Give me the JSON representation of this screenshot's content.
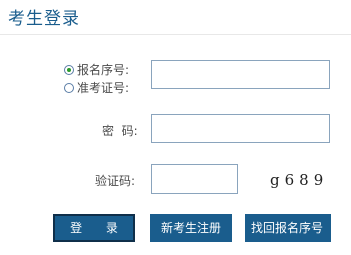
{
  "page": {
    "title": "考生登录"
  },
  "form": {
    "id_options": [
      {
        "label": "报名序号:",
        "checked": true
      },
      {
        "label": "准考证号:",
        "checked": false
      }
    ],
    "id_value": "",
    "password_label": "密  码:",
    "password_value": "",
    "captcha_label": "验证码:",
    "captcha_value": "",
    "captcha_text": "g689"
  },
  "buttons": {
    "login": "登 录",
    "register": "新考生注册",
    "recover": "找回报名序号"
  },
  "colors": {
    "accent": "#1a5d8d",
    "radio_checked": "#2b9a2b"
  }
}
